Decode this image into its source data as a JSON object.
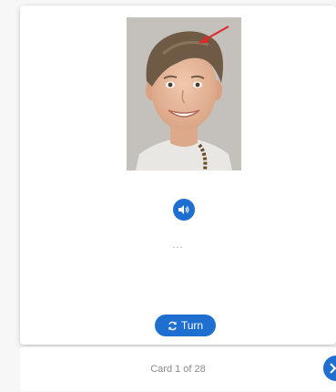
{
  "card": {
    "ellipsis": "...",
    "turn_label": "Turn"
  },
  "footer": {
    "card_count": "Card 1 of 28"
  },
  "icons": {
    "audio": "speaker-icon",
    "turn": "refresh-icon",
    "next": "chevron-right-icon"
  },
  "colors": {
    "accent": "#1f6fd1",
    "arrow": "#e0262b"
  }
}
